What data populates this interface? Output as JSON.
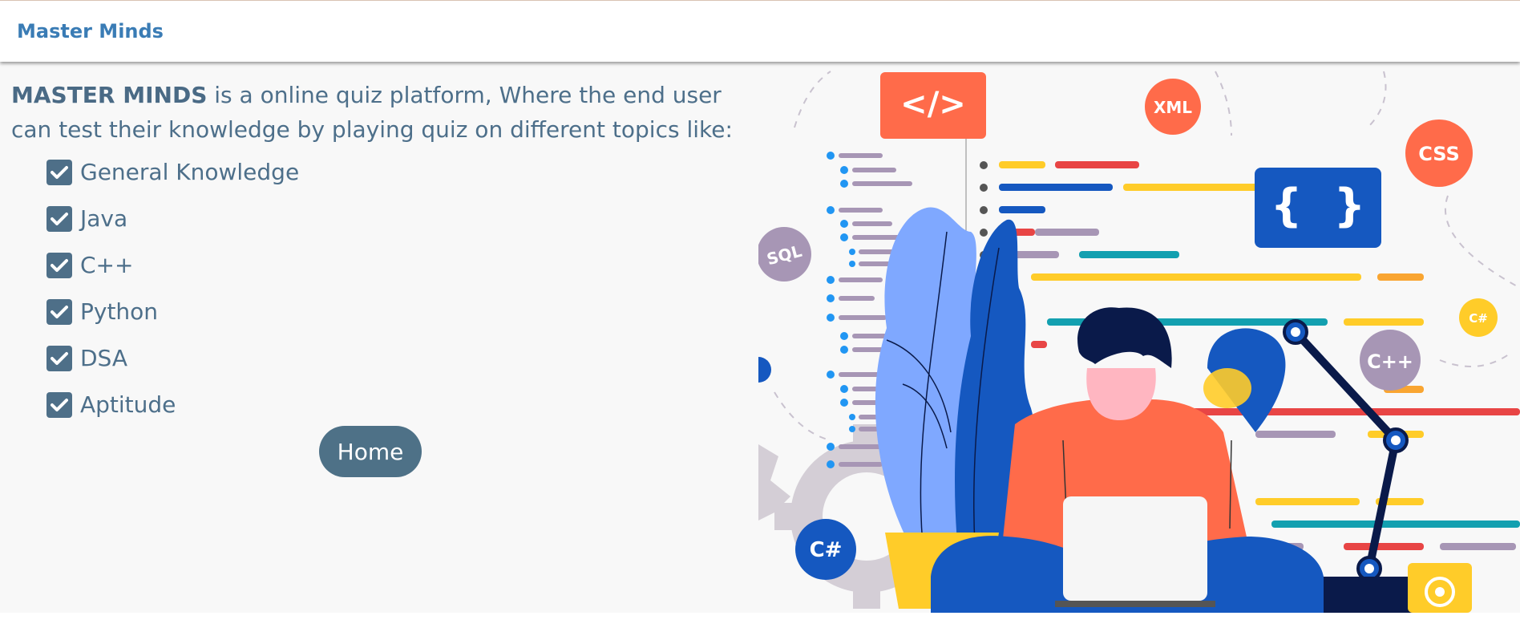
{
  "navbar": {
    "brand": "Master Minds"
  },
  "intro": {
    "brand_bold": "MASTER MINDS",
    "text": " is a online quiz platform, Where the end user can test their knowledge by playing quiz on different topics like:"
  },
  "topics": [
    {
      "label": "General Knowledge",
      "checked": true
    },
    {
      "label": "Java",
      "checked": true
    },
    {
      "label": "C++",
      "checked": true
    },
    {
      "label": "Python",
      "checked": true
    },
    {
      "label": "DSA",
      "checked": true
    },
    {
      "label": "Aptitude",
      "checked": true
    }
  ],
  "home_button": {
    "label": "Home"
  },
  "illustration": {
    "badges": {
      "code": "</>",
      "xml": "XML",
      "css": "CSS",
      "sql": "SQL",
      "csharp_small": "C#",
      "cpp": "C++",
      "csharp": "C#",
      "braces": "{  }"
    }
  },
  "colors": {
    "brand": "#3a7cb5",
    "text": "#4d6f8a",
    "button": "#4e7187",
    "orange": "#ff6b4a",
    "blue": "#1558c0",
    "yellow": "#ffcc29",
    "purple": "#a796b5"
  }
}
